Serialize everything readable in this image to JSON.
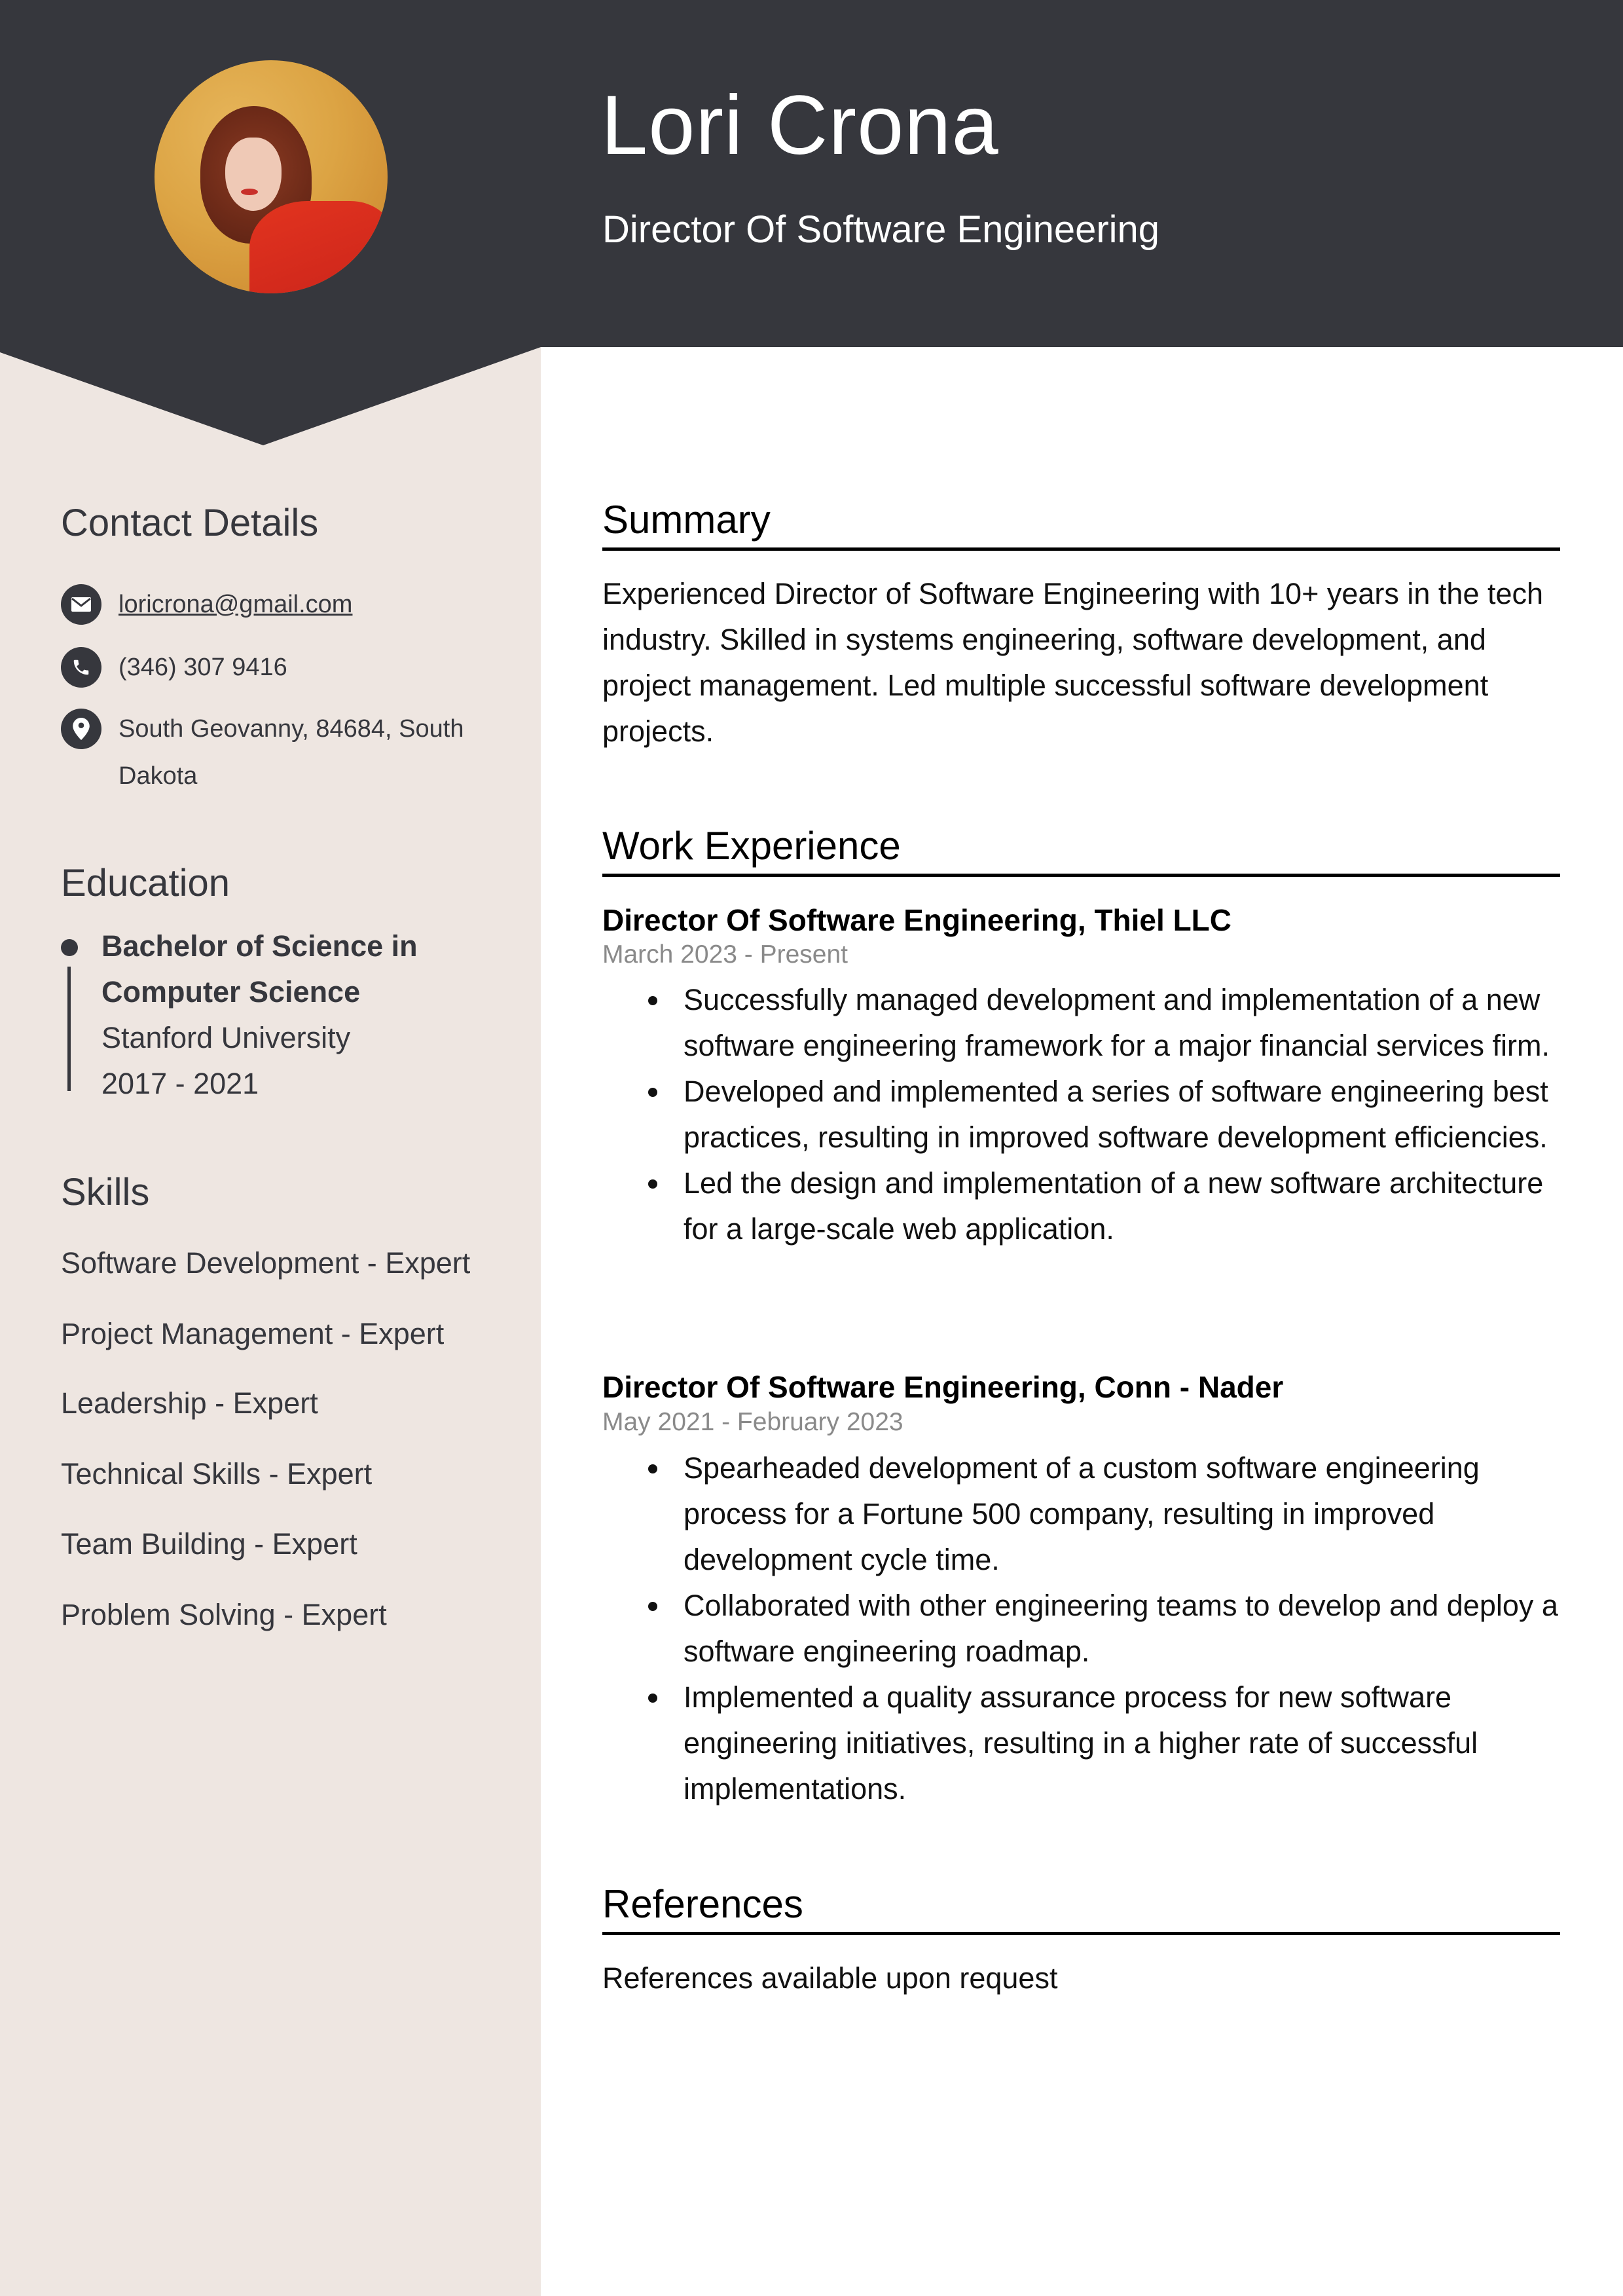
{
  "header": {
    "name": "Lori Crona",
    "title": "Director Of Software Engineering",
    "photo_alt": "profile-photo"
  },
  "colors": {
    "header_bg": "#36373d",
    "sidebar_bg": "#eee6e1",
    "date_gray": "#8a8a8a"
  },
  "sidebar": {
    "contact": {
      "heading": "Contact Details",
      "items": [
        {
          "icon": "envelope-icon",
          "text": "loricrona@gmail.com"
        },
        {
          "icon": "phone-icon",
          "text": "(346) 307 9416"
        },
        {
          "icon": "map-pin-icon",
          "text": "South Geovanny, 84684, South Dakota"
        }
      ]
    },
    "education": {
      "heading": "Education",
      "items": [
        {
          "degree": "Bachelor of Science in Computer Science",
          "school": "Stanford University",
          "years": "2017 - 2021"
        }
      ]
    },
    "skills": {
      "heading": "Skills",
      "items": [
        "Software Development - Expert",
        "Project Management - Expert",
        "Leadership - Expert",
        "Technical Skills - Expert",
        "Team Building - Expert",
        "Problem Solving - Expert"
      ]
    }
  },
  "main": {
    "summary": {
      "heading": "Summary",
      "text": "Experienced Director of Software Engineering with 10+ years in the tech industry. Skilled in systems engineering, software development, and project management. Led multiple successful software development projects."
    },
    "work": {
      "heading": "Work Experience",
      "jobs": [
        {
          "title": "Director Of Software Engineering, Thiel LLC",
          "dates": "March 2023 - Present",
          "bullets": [
            "Successfully managed development and implementation of a new software engineering framework for a major financial services firm.",
            "Developed and implemented a series of software engineering best practices, resulting in improved software development efficiencies.",
            "Led the design and implementation of a new software architecture for a large-scale web application."
          ]
        },
        {
          "title": "Director Of Software Engineering, Conn - Nader",
          "dates": "May 2021 - February 2023",
          "bullets": [
            "Spearheaded development of a custom software engineering process for a Fortune 500 company, resulting in improved development cycle time.",
            "Collaborated with other engineering teams to develop and deploy a software engineering roadmap.",
            "Implemented a quality assurance process for new software engineering initiatives, resulting in a higher rate of successful implementations."
          ]
        }
      ]
    },
    "references": {
      "heading": "References",
      "text": "References available upon request"
    }
  }
}
